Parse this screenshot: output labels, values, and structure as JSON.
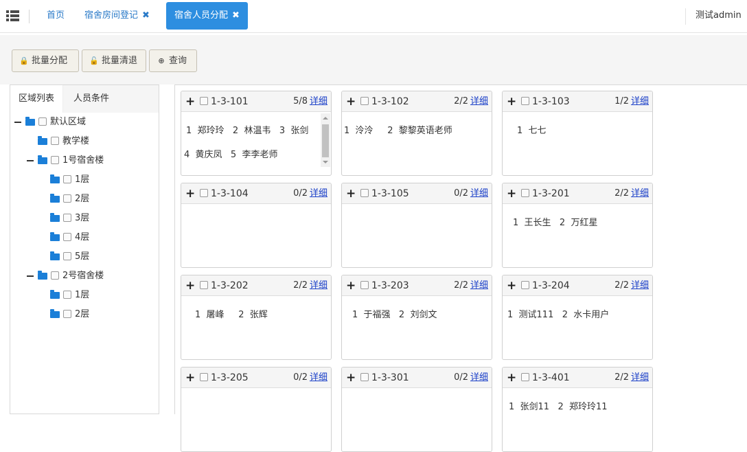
{
  "topbar": {
    "tabs": [
      {
        "label": "首页",
        "closable": false
      },
      {
        "label": "宿舍房间登记",
        "closable": true
      },
      {
        "label": "宿舍人员分配",
        "closable": true,
        "active": true
      }
    ],
    "close_glyph": "✖",
    "user": "测试admin"
  },
  "toolbar": {
    "batch_assign": "批量分配",
    "batch_clear": "批量清退",
    "query": "查询"
  },
  "left": {
    "tabs": [
      "区域列表",
      "人员条件"
    ],
    "tree": [
      {
        "label": "默认区域",
        "level": 0,
        "expanded": true
      },
      {
        "label": "教学楼",
        "level": 1
      },
      {
        "label": "1号宿舍楼",
        "level": 1,
        "expanded": true
      },
      {
        "label": "1层",
        "level": 2
      },
      {
        "label": "2层",
        "level": 2
      },
      {
        "label": "3层",
        "level": 2
      },
      {
        "label": "4层",
        "level": 2
      },
      {
        "label": "5层",
        "level": 2
      },
      {
        "label": "2号宿舍楼",
        "level": 1,
        "expanded": true
      },
      {
        "label": "1层",
        "level": 2
      },
      {
        "label": "2层",
        "level": 2
      }
    ]
  },
  "rooms": {
    "detail_label": "详细",
    "items": [
      {
        "name": "1-3-101",
        "count": "5/8",
        "lines": [
          "1  郑玲玲   2  林温韦   3  张剑",
          "4  黄庆凤   5  李李老师"
        ],
        "scroll": true
      },
      {
        "name": "1-3-102",
        "count": "2/2",
        "lines": [
          "1  泠泠     2  黎黎英语老师"
        ]
      },
      {
        "name": "1-3-103",
        "count": "1/2",
        "lines": [
          "1  七七"
        ]
      },
      {
        "name": "1-3-104",
        "count": "0/2",
        "lines": []
      },
      {
        "name": "1-3-105",
        "count": "0/2",
        "lines": []
      },
      {
        "name": "1-3-201",
        "count": "2/2",
        "lines": [
          "1  王长生   2  万红星"
        ]
      },
      {
        "name": "1-3-202",
        "count": "2/2",
        "lines": [
          "1  屠峰     2  张辉"
        ]
      },
      {
        "name": "1-3-203",
        "count": "2/2",
        "lines": [
          "1  于福强   2  刘剑文"
        ]
      },
      {
        "name": "1-3-204",
        "count": "2/2",
        "lines": [
          "1  测试111   2  水卡用户"
        ]
      },
      {
        "name": "1-3-205",
        "count": "0/2",
        "lines": []
      },
      {
        "name": "1-3-301",
        "count": "0/2",
        "lines": []
      },
      {
        "name": "1-3-401",
        "count": "2/2",
        "lines": [
          "1  张剑11   2  郑玲玲11"
        ]
      }
    ]
  }
}
